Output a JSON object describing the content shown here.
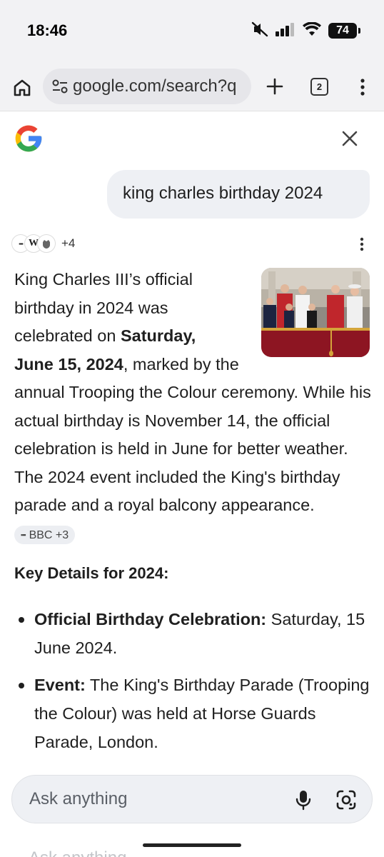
{
  "status_bar": {
    "time": "18:46",
    "battery": "74",
    "icons": [
      "mute-icon",
      "signal-icon",
      "wifi-icon",
      "battery-icon"
    ]
  },
  "browser": {
    "url": "google.com/search?q",
    "tab_count": "2"
  },
  "query": "king charles birthday 2024",
  "sources": {
    "icons": [
      "bbc-icon",
      "wikipedia-icon",
      "royal-crest-icon"
    ],
    "more_count": "+4"
  },
  "answer": {
    "part1": "King Charles III’s official birthday in 2024 was celebrated on ",
    "bold": "Saturday, June 15, 2024",
    "part2": ", marked by the annual Trooping the Colour ceremony. While his actual birthday is November 14, the official celebration is held in June for better weather. The 2024 event included the King's birthday parade and a royal balcony appearance. ",
    "citation": "BBC +3"
  },
  "key_details": {
    "heading": "Key Details for 2024:",
    "items": [
      {
        "label": "Official Birthday Celebration:",
        "text": " Saturday, 15 June 2024."
      },
      {
        "label": "Event:",
        "text": " The King's Birthday Parade (Trooping the Colour) was held at Horse Guards Parade, London."
      }
    ]
  },
  "ask_bar": {
    "placeholder": "Ask anything"
  },
  "colors": {
    "google_blue": "#4285F4",
    "google_red": "#EA4335",
    "google_yellow": "#FBBC05",
    "google_green": "#34A853"
  }
}
